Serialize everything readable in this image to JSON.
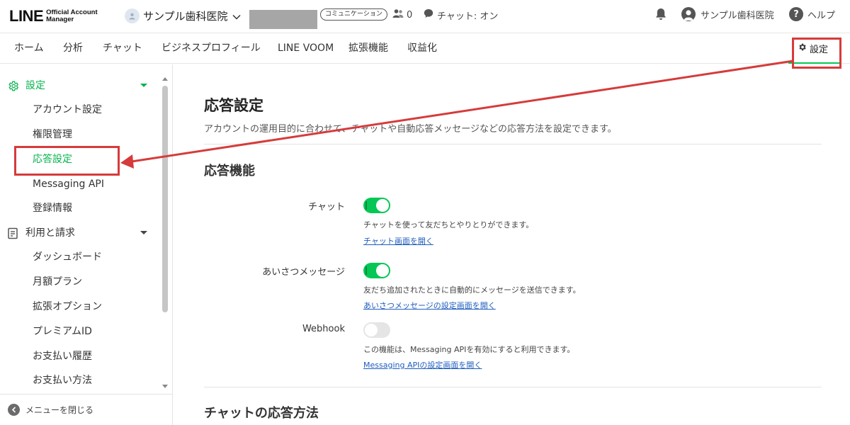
{
  "header": {
    "logo_main": "LINE",
    "logo_sub_1": "Official Account",
    "logo_sub_2": "Manager",
    "account_name": "サンプル歯科医院",
    "plan_badge": "コミュニケーション",
    "friends_count": "0",
    "chat_status": "チャット: オン",
    "user_name": "サンプル歯科医院",
    "help_label": "ヘルプ"
  },
  "nav": {
    "items": [
      "ホーム",
      "分析",
      "チャット",
      "ビジネスプロフィール",
      "LINE VOOM",
      "拡張機能",
      "収益化"
    ],
    "settings_label": "設定"
  },
  "sidebar": {
    "group_settings": "設定",
    "settings_items": [
      "アカウント設定",
      "権限管理",
      "応答設定",
      "Messaging API",
      "登録情報"
    ],
    "group_billing": "利用と請求",
    "billing_items": [
      "ダッシュボード",
      "月額プラン",
      "拡張オプション",
      "プレミアムID",
      "お支払い履歴",
      "お支払い方法"
    ],
    "collapse_label": "メニューを閉じる"
  },
  "main": {
    "title": "応答設定",
    "description": "アカウントの運用目的に合わせて、チャットや自動応答メッセージなどの応答方法を設定できます。",
    "section_features": "応答機能",
    "rows": [
      {
        "label": "チャット",
        "enabled": true,
        "desc": "チャットを使って友だちとやりとりができます。",
        "link": "チャット画面を開く"
      },
      {
        "label": "あいさつメッセージ",
        "enabled": true,
        "desc": "友だち追加されたときに自動的にメッセージを送信できます。",
        "link": "あいさつメッセージの設定画面を開く"
      },
      {
        "label": "Webhook",
        "enabled": false,
        "desc": "この機能は、Messaging APIを有効にすると利用できます。",
        "link": "Messaging APIの設定画面を開く"
      }
    ],
    "section_chat_method": "チャットの応答方法"
  },
  "colors": {
    "accent_green": "#06c755",
    "annotation_red": "#d63b3b",
    "link_blue": "#1f5dbf"
  }
}
